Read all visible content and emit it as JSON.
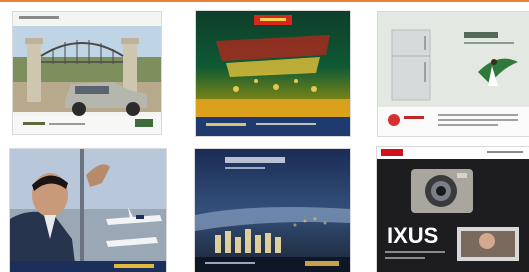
{
  "colors": {
    "accent_line": "#e8813a",
    "background": "#ffffff"
  },
  "thumbnails": [
    {
      "subject": "suv-in-front-of-castle-gate"
    },
    {
      "subject": "golden-green-poster-with-red-banner"
    },
    {
      "subject": "white-refrigerator-with-dancer"
    },
    {
      "subject": "businessman-at-airport-window"
    },
    {
      "subject": "city-skyline-at-dusk"
    },
    {
      "subject": "camera-product-ad"
    }
  ],
  "ad6": {
    "headline": "IXUS"
  }
}
